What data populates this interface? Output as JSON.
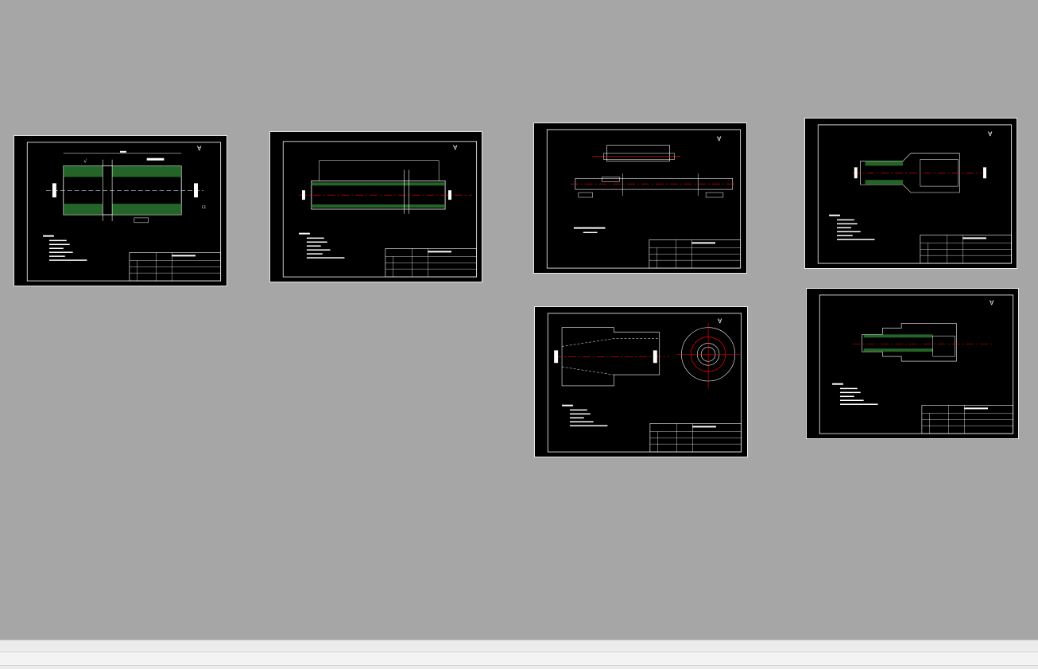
{
  "workspace": {
    "background": "#a6a6a6",
    "sheet_background": "#000000",
    "sheet_border": "#e8e8e8",
    "line_color": "#ffffff",
    "centerline_color": "#ff0000",
    "hatch_color": "#00cc00"
  },
  "sheets": [
    {
      "id": "sheet-1",
      "note_title": "技术要求:",
      "title_block_code": "YLX2-1-0002阀杆"
    },
    {
      "id": "sheet-2",
      "note_title": "技术要求:",
      "title_block_code": "ZJQ02-0-0002阀杆"
    },
    {
      "id": "sheet-3",
      "note_title": "技术要求:",
      "title_block_code": "YLX2-1-0003阀杆"
    },
    {
      "id": "sheet-4",
      "note_title": "技术要求:",
      "title_block_code": "YLX2-1-0002阀杆"
    },
    {
      "id": "sheet-5",
      "note_title": "技术要求:",
      "title_block_code": "YLX2-1-0005阀座"
    },
    {
      "id": "sheet-6",
      "note_title": "技术要求:",
      "title_block_code": "YLX2-1-0006阀套"
    }
  ],
  "status_bar": {
    "label": ""
  }
}
